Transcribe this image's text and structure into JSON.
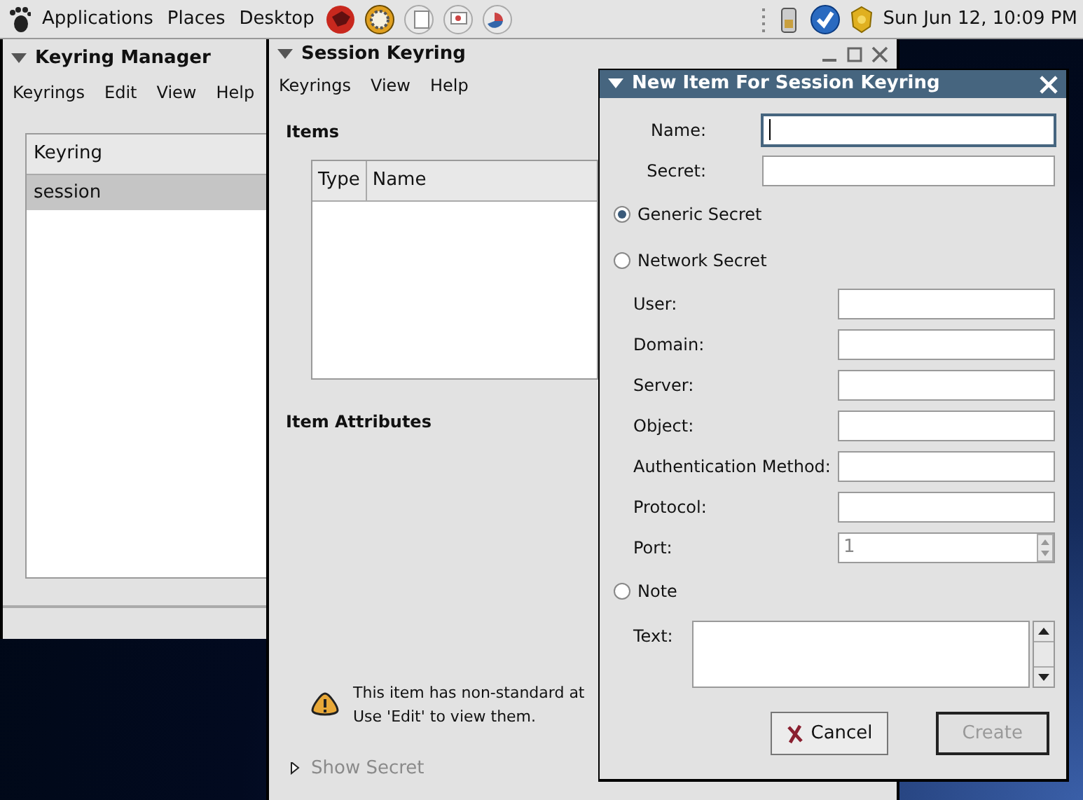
{
  "top_panel": {
    "menus": [
      "Applications",
      "Places",
      "Desktop"
    ],
    "clock": "Sun Jun 12, 10:09 PM"
  },
  "keyring_manager": {
    "title": "Keyring Manager",
    "menus": [
      "Keyrings",
      "Edit",
      "View",
      "Help"
    ],
    "column": "Keyring",
    "rows": [
      {
        "label": "session",
        "selected": true
      }
    ]
  },
  "session_keyring": {
    "title": "Session Keyring",
    "menus": [
      "Keyrings",
      "View",
      "Help"
    ],
    "items_heading": "Items",
    "columns": [
      "Type",
      "Name"
    ],
    "attributes_heading": "Item Attributes",
    "warning": "This item has non-standard at\nUse 'Edit' to view them.",
    "expander": {
      "label": "Show Secret",
      "expanded": false,
      "disabled": true
    }
  },
  "dialog": {
    "title": "New Item For Session Keyring",
    "form": [
      {
        "kind": "field",
        "label": "Name:",
        "focused": true
      },
      {
        "kind": "field",
        "label": "Secret:",
        "focused": false
      },
      {
        "kind": "radio",
        "label": "Generic Secret",
        "selected": true
      },
      {
        "kind": "radio",
        "label": "Network Secret",
        "selected": false
      },
      {
        "kind": "subfield",
        "label": "User:",
        "focused": false
      },
      {
        "kind": "subfield",
        "label": "Domain:",
        "focused": false
      },
      {
        "kind": "subfield",
        "label": "Server:",
        "focused": false
      },
      {
        "kind": "subfield",
        "label": "Object:",
        "focused": false
      },
      {
        "kind": "subfield",
        "label": "Authentication Method:",
        "focused": false
      },
      {
        "kind": "subfield",
        "label": "Protocol:",
        "focused": false
      },
      {
        "kind": "spin",
        "label": "Port:",
        "value": "1"
      },
      {
        "kind": "radio",
        "label": "Note",
        "selected": false
      },
      {
        "kind": "textarea",
        "label": "Text:"
      }
    ],
    "buttons": [
      {
        "kind": "cancel",
        "label": "Cancel",
        "disabled": false
      },
      {
        "kind": "create",
        "label": "Create",
        "disabled": true
      }
    ]
  }
}
